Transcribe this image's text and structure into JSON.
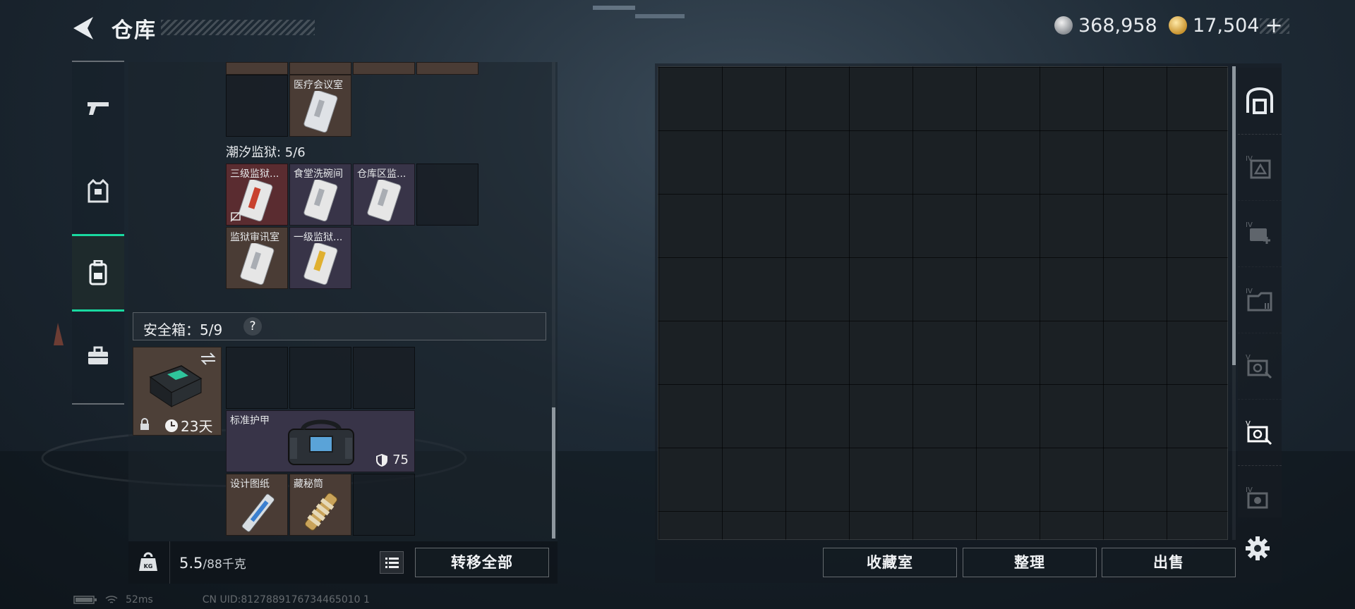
{
  "header": {
    "title": "仓库",
    "currency_silver": "368,958",
    "currency_gold": "17,504"
  },
  "left_tabs": [
    {
      "name": "weapons",
      "icon": "pistol-icon"
    },
    {
      "name": "equipment",
      "icon": "vest-icon"
    },
    {
      "name": "backpack",
      "icon": "backpack-icon",
      "active": true
    },
    {
      "name": "toolbox",
      "icon": "briefcase-icon"
    }
  ],
  "keycards": {
    "top_row_label": "医疗会议室",
    "section_title": "潮汐监狱: 5/6",
    "row1": [
      "三级监狱...",
      "食堂洗碗间",
      "仓库区监..."
    ],
    "row2": [
      "监狱审讯室",
      "一级监狱..."
    ]
  },
  "safe": {
    "header": "安全箱：5/9",
    "question": "?",
    "days": "23天"
  },
  "items": {
    "armor_label": "标准护甲",
    "armor_value": "75",
    "blueprint_label": "设计图纸",
    "cylinder_label": "藏秘筒"
  },
  "bottom": {
    "weight_current": "5.5",
    "weight_max": "/88千克",
    "transfer_all": "转移全部",
    "collection": "收藏室",
    "organize": "整理",
    "sell": "出售"
  },
  "status": {
    "ping": "52ms",
    "uid": "CN UID:8127889176734465010 1"
  },
  "colors": {
    "accent": "#19d9a0",
    "cell_brown": "#4a3c35",
    "cell_red": "#5a2c30",
    "cell_purple": "#383448"
  }
}
